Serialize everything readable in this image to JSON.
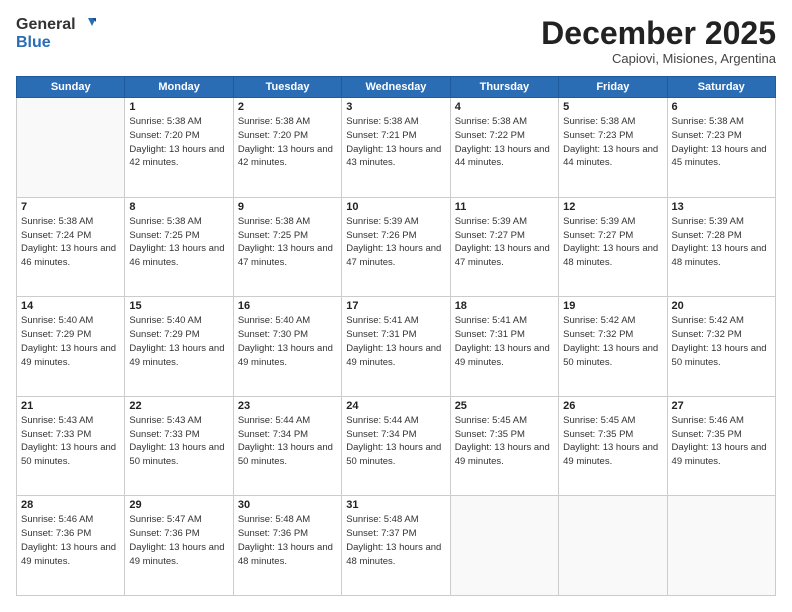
{
  "logo": {
    "general": "General",
    "blue": "Blue"
  },
  "header": {
    "month": "December 2025",
    "location": "Capiovi, Misiones, Argentina"
  },
  "weekdays": [
    "Sunday",
    "Monday",
    "Tuesday",
    "Wednesday",
    "Thursday",
    "Friday",
    "Saturday"
  ],
  "weeks": [
    [
      {
        "day": null
      },
      {
        "day": 1,
        "sunrise": "5:38 AM",
        "sunset": "7:20 PM",
        "daylight": "13 hours and 42 minutes."
      },
      {
        "day": 2,
        "sunrise": "5:38 AM",
        "sunset": "7:20 PM",
        "daylight": "13 hours and 42 minutes."
      },
      {
        "day": 3,
        "sunrise": "5:38 AM",
        "sunset": "7:21 PM",
        "daylight": "13 hours and 43 minutes."
      },
      {
        "day": 4,
        "sunrise": "5:38 AM",
        "sunset": "7:22 PM",
        "daylight": "13 hours and 44 minutes."
      },
      {
        "day": 5,
        "sunrise": "5:38 AM",
        "sunset": "7:23 PM",
        "daylight": "13 hours and 44 minutes."
      },
      {
        "day": 6,
        "sunrise": "5:38 AM",
        "sunset": "7:23 PM",
        "daylight": "13 hours and 45 minutes."
      }
    ],
    [
      {
        "day": 7,
        "sunrise": "5:38 AM",
        "sunset": "7:24 PM",
        "daylight": "13 hours and 46 minutes."
      },
      {
        "day": 8,
        "sunrise": "5:38 AM",
        "sunset": "7:25 PM",
        "daylight": "13 hours and 46 minutes."
      },
      {
        "day": 9,
        "sunrise": "5:38 AM",
        "sunset": "7:25 PM",
        "daylight": "13 hours and 47 minutes."
      },
      {
        "day": 10,
        "sunrise": "5:39 AM",
        "sunset": "7:26 PM",
        "daylight": "13 hours and 47 minutes."
      },
      {
        "day": 11,
        "sunrise": "5:39 AM",
        "sunset": "7:27 PM",
        "daylight": "13 hours and 47 minutes."
      },
      {
        "day": 12,
        "sunrise": "5:39 AM",
        "sunset": "7:27 PM",
        "daylight": "13 hours and 48 minutes."
      },
      {
        "day": 13,
        "sunrise": "5:39 AM",
        "sunset": "7:28 PM",
        "daylight": "13 hours and 48 minutes."
      }
    ],
    [
      {
        "day": 14,
        "sunrise": "5:40 AM",
        "sunset": "7:29 PM",
        "daylight": "13 hours and 49 minutes."
      },
      {
        "day": 15,
        "sunrise": "5:40 AM",
        "sunset": "7:29 PM",
        "daylight": "13 hours and 49 minutes."
      },
      {
        "day": 16,
        "sunrise": "5:40 AM",
        "sunset": "7:30 PM",
        "daylight": "13 hours and 49 minutes."
      },
      {
        "day": 17,
        "sunrise": "5:41 AM",
        "sunset": "7:31 PM",
        "daylight": "13 hours and 49 minutes."
      },
      {
        "day": 18,
        "sunrise": "5:41 AM",
        "sunset": "7:31 PM",
        "daylight": "13 hours and 49 minutes."
      },
      {
        "day": 19,
        "sunrise": "5:42 AM",
        "sunset": "7:32 PM",
        "daylight": "13 hours and 50 minutes."
      },
      {
        "day": 20,
        "sunrise": "5:42 AM",
        "sunset": "7:32 PM",
        "daylight": "13 hours and 50 minutes."
      }
    ],
    [
      {
        "day": 21,
        "sunrise": "5:43 AM",
        "sunset": "7:33 PM",
        "daylight": "13 hours and 50 minutes."
      },
      {
        "day": 22,
        "sunrise": "5:43 AM",
        "sunset": "7:33 PM",
        "daylight": "13 hours and 50 minutes."
      },
      {
        "day": 23,
        "sunrise": "5:44 AM",
        "sunset": "7:34 PM",
        "daylight": "13 hours and 50 minutes."
      },
      {
        "day": 24,
        "sunrise": "5:44 AM",
        "sunset": "7:34 PM",
        "daylight": "13 hours and 50 minutes."
      },
      {
        "day": 25,
        "sunrise": "5:45 AM",
        "sunset": "7:35 PM",
        "daylight": "13 hours and 49 minutes."
      },
      {
        "day": 26,
        "sunrise": "5:45 AM",
        "sunset": "7:35 PM",
        "daylight": "13 hours and 49 minutes."
      },
      {
        "day": 27,
        "sunrise": "5:46 AM",
        "sunset": "7:35 PM",
        "daylight": "13 hours and 49 minutes."
      }
    ],
    [
      {
        "day": 28,
        "sunrise": "5:46 AM",
        "sunset": "7:36 PM",
        "daylight": "13 hours and 49 minutes."
      },
      {
        "day": 29,
        "sunrise": "5:47 AM",
        "sunset": "7:36 PM",
        "daylight": "13 hours and 49 minutes."
      },
      {
        "day": 30,
        "sunrise": "5:48 AM",
        "sunset": "7:36 PM",
        "daylight": "13 hours and 48 minutes."
      },
      {
        "day": 31,
        "sunrise": "5:48 AM",
        "sunset": "7:37 PM",
        "daylight": "13 hours and 48 minutes."
      },
      {
        "day": null
      },
      {
        "day": null
      },
      {
        "day": null
      }
    ]
  ]
}
